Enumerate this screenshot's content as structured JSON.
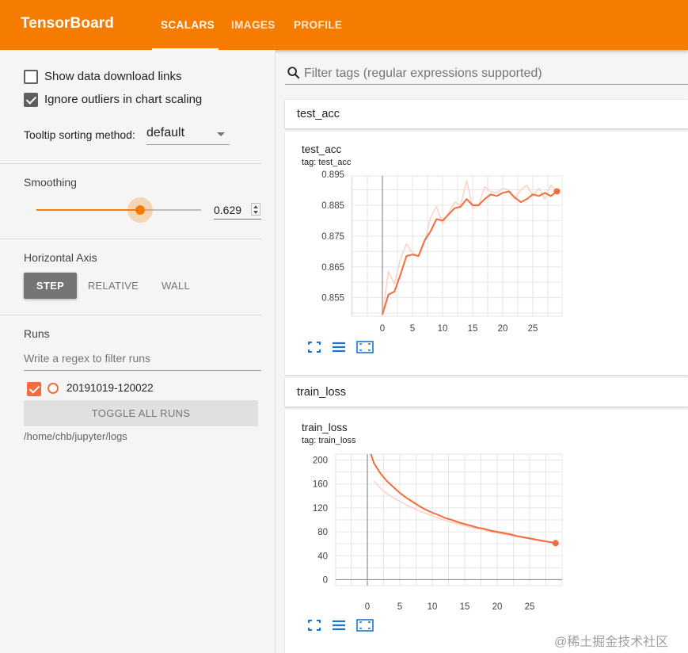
{
  "app": {
    "brand": "TensorBoard",
    "tabs": [
      {
        "label": "SCALARS",
        "active": true
      },
      {
        "label": "IMAGES",
        "active": false
      },
      {
        "label": "PROFILE",
        "active": false
      }
    ],
    "accent_color": "#f57c00"
  },
  "sidebar": {
    "show_download_links": {
      "label": "Show data download links",
      "checked": false
    },
    "ignore_outliers": {
      "label": "Ignore outliers in chart scaling",
      "checked": true
    },
    "tooltip_sorting": {
      "label": "Tooltip sorting method:",
      "value": "default"
    },
    "smoothing": {
      "title": "Smoothing",
      "value": "0.629",
      "fraction": 0.629
    },
    "horizontal_axis": {
      "title": "Horizontal Axis",
      "options": [
        {
          "label": "STEP",
          "active": true
        },
        {
          "label": "RELATIVE",
          "active": false
        },
        {
          "label": "WALL",
          "active": false
        }
      ]
    },
    "runs": {
      "title": "Runs",
      "filter_placeholder": "Write a regex to filter runs",
      "items": [
        {
          "name": "20191019-120022",
          "checked": true,
          "color": "#f26d3d"
        }
      ],
      "toggle_label": "TOGGLE ALL RUNS",
      "logdir": "/home/chb/jupyter/logs"
    }
  },
  "main": {
    "filter_placeholder": "Filter tags (regular expressions supported)",
    "categories": [
      {
        "name": "test_acc",
        "card_title": "test_acc",
        "card_tag": "tag: test_acc"
      },
      {
        "name": "train_loss",
        "card_title": "train_loss",
        "card_tag": "tag: train_loss"
      }
    ]
  },
  "watermark": "@稀土掘金技术社区",
  "chart_data": [
    {
      "type": "line",
      "title": "test_acc",
      "xlabel": "",
      "ylabel": "",
      "xlim": [
        0,
        29
      ],
      "ylim": [
        0.849,
        0.8945
      ],
      "xticks": [
        0,
        5,
        10,
        15,
        20,
        25
      ],
      "yticks": [
        0.855,
        0.865,
        0.875,
        0.885,
        0.895
      ],
      "ytick_labels": [
        "0.855",
        "0.865",
        "0.875",
        "0.885",
        "0.895"
      ],
      "grid": true,
      "series": [
        {
          "style": "raw",
          "color": "#fbd4c6",
          "x": [
            0,
            1,
            2,
            3,
            4,
            5,
            6,
            7,
            8,
            9,
            10,
            11,
            12,
            13,
            14,
            15,
            16,
            17,
            18,
            19,
            20,
            21,
            22,
            23,
            24,
            25,
            26,
            27,
            28,
            29
          ],
          "y": [
            0.849,
            0.8635,
            0.8595,
            0.8675,
            0.8725,
            0.8695,
            0.8685,
            0.873,
            0.881,
            0.8845,
            0.879,
            0.8825,
            0.886,
            0.885,
            0.893,
            0.884,
            0.885,
            0.891,
            0.8895,
            0.889,
            0.8905,
            0.89,
            0.887,
            0.89,
            0.8915,
            0.888,
            0.8905,
            0.887,
            0.8915,
            0.8895
          ]
        },
        {
          "style": "smoothed",
          "color": "#f26d3d",
          "x": [
            0,
            1,
            2,
            3,
            4,
            5,
            6,
            7,
            8,
            9,
            10,
            11,
            12,
            13,
            14,
            15,
            16,
            17,
            18,
            19,
            20,
            21,
            22,
            23,
            24,
            25,
            26,
            27,
            28,
            29
          ],
          "y": [
            0.8495,
            0.856,
            0.857,
            0.8625,
            0.8685,
            0.869,
            0.8685,
            0.8735,
            0.8765,
            0.8805,
            0.88,
            0.882,
            0.884,
            0.8845,
            0.887,
            0.885,
            0.885,
            0.887,
            0.8885,
            0.888,
            0.889,
            0.8895,
            0.8875,
            0.886,
            0.887,
            0.8885,
            0.888,
            0.889,
            0.888,
            0.8895
          ]
        }
      ]
    },
    {
      "type": "line",
      "title": "train_loss",
      "xlabel": "",
      "ylabel": "",
      "xlim": [
        0,
        29
      ],
      "ylim": [
        -10,
        210
      ],
      "xticks": [
        0,
        5,
        10,
        15,
        20,
        25
      ],
      "yticks": [
        0,
        40,
        80,
        120,
        160,
        200
      ],
      "ytick_labels": [
        "0",
        "40",
        "80",
        "120",
        "160",
        "200"
      ],
      "grid": true,
      "series": [
        {
          "style": "raw",
          "color": "#fbd4c6",
          "x": [
            1,
            2,
            3,
            4,
            5,
            6,
            7,
            8,
            9,
            10,
            11,
            12,
            13,
            14,
            15,
            16,
            17,
            18,
            19,
            20,
            21,
            22,
            23,
            24,
            25,
            26,
            27,
            28,
            29
          ],
          "y": [
            165,
            153,
            144,
            137,
            131,
            125,
            120,
            115,
            111,
            107,
            103,
            99,
            96,
            93,
            90,
            87,
            85,
            83,
            80,
            78,
            76,
            74,
            72,
            70,
            68,
            66,
            64,
            63,
            61
          ]
        },
        {
          "style": "smoothed",
          "color": "#f26d3d",
          "x": [
            0.5,
            1,
            2,
            3,
            4,
            5,
            6,
            7,
            8,
            9,
            10,
            11,
            12,
            13,
            14,
            15,
            16,
            17,
            18,
            19,
            20,
            21,
            22,
            23,
            24,
            25,
            26,
            27,
            28,
            29
          ],
          "y": [
            212,
            195,
            178,
            165,
            155,
            145,
            137,
            130,
            123,
            117,
            112,
            108,
            103,
            100,
            96,
            93,
            90,
            87,
            85,
            82,
            80,
            78,
            76,
            73,
            71,
            69,
            67,
            65,
            63,
            61
          ]
        }
      ]
    }
  ]
}
